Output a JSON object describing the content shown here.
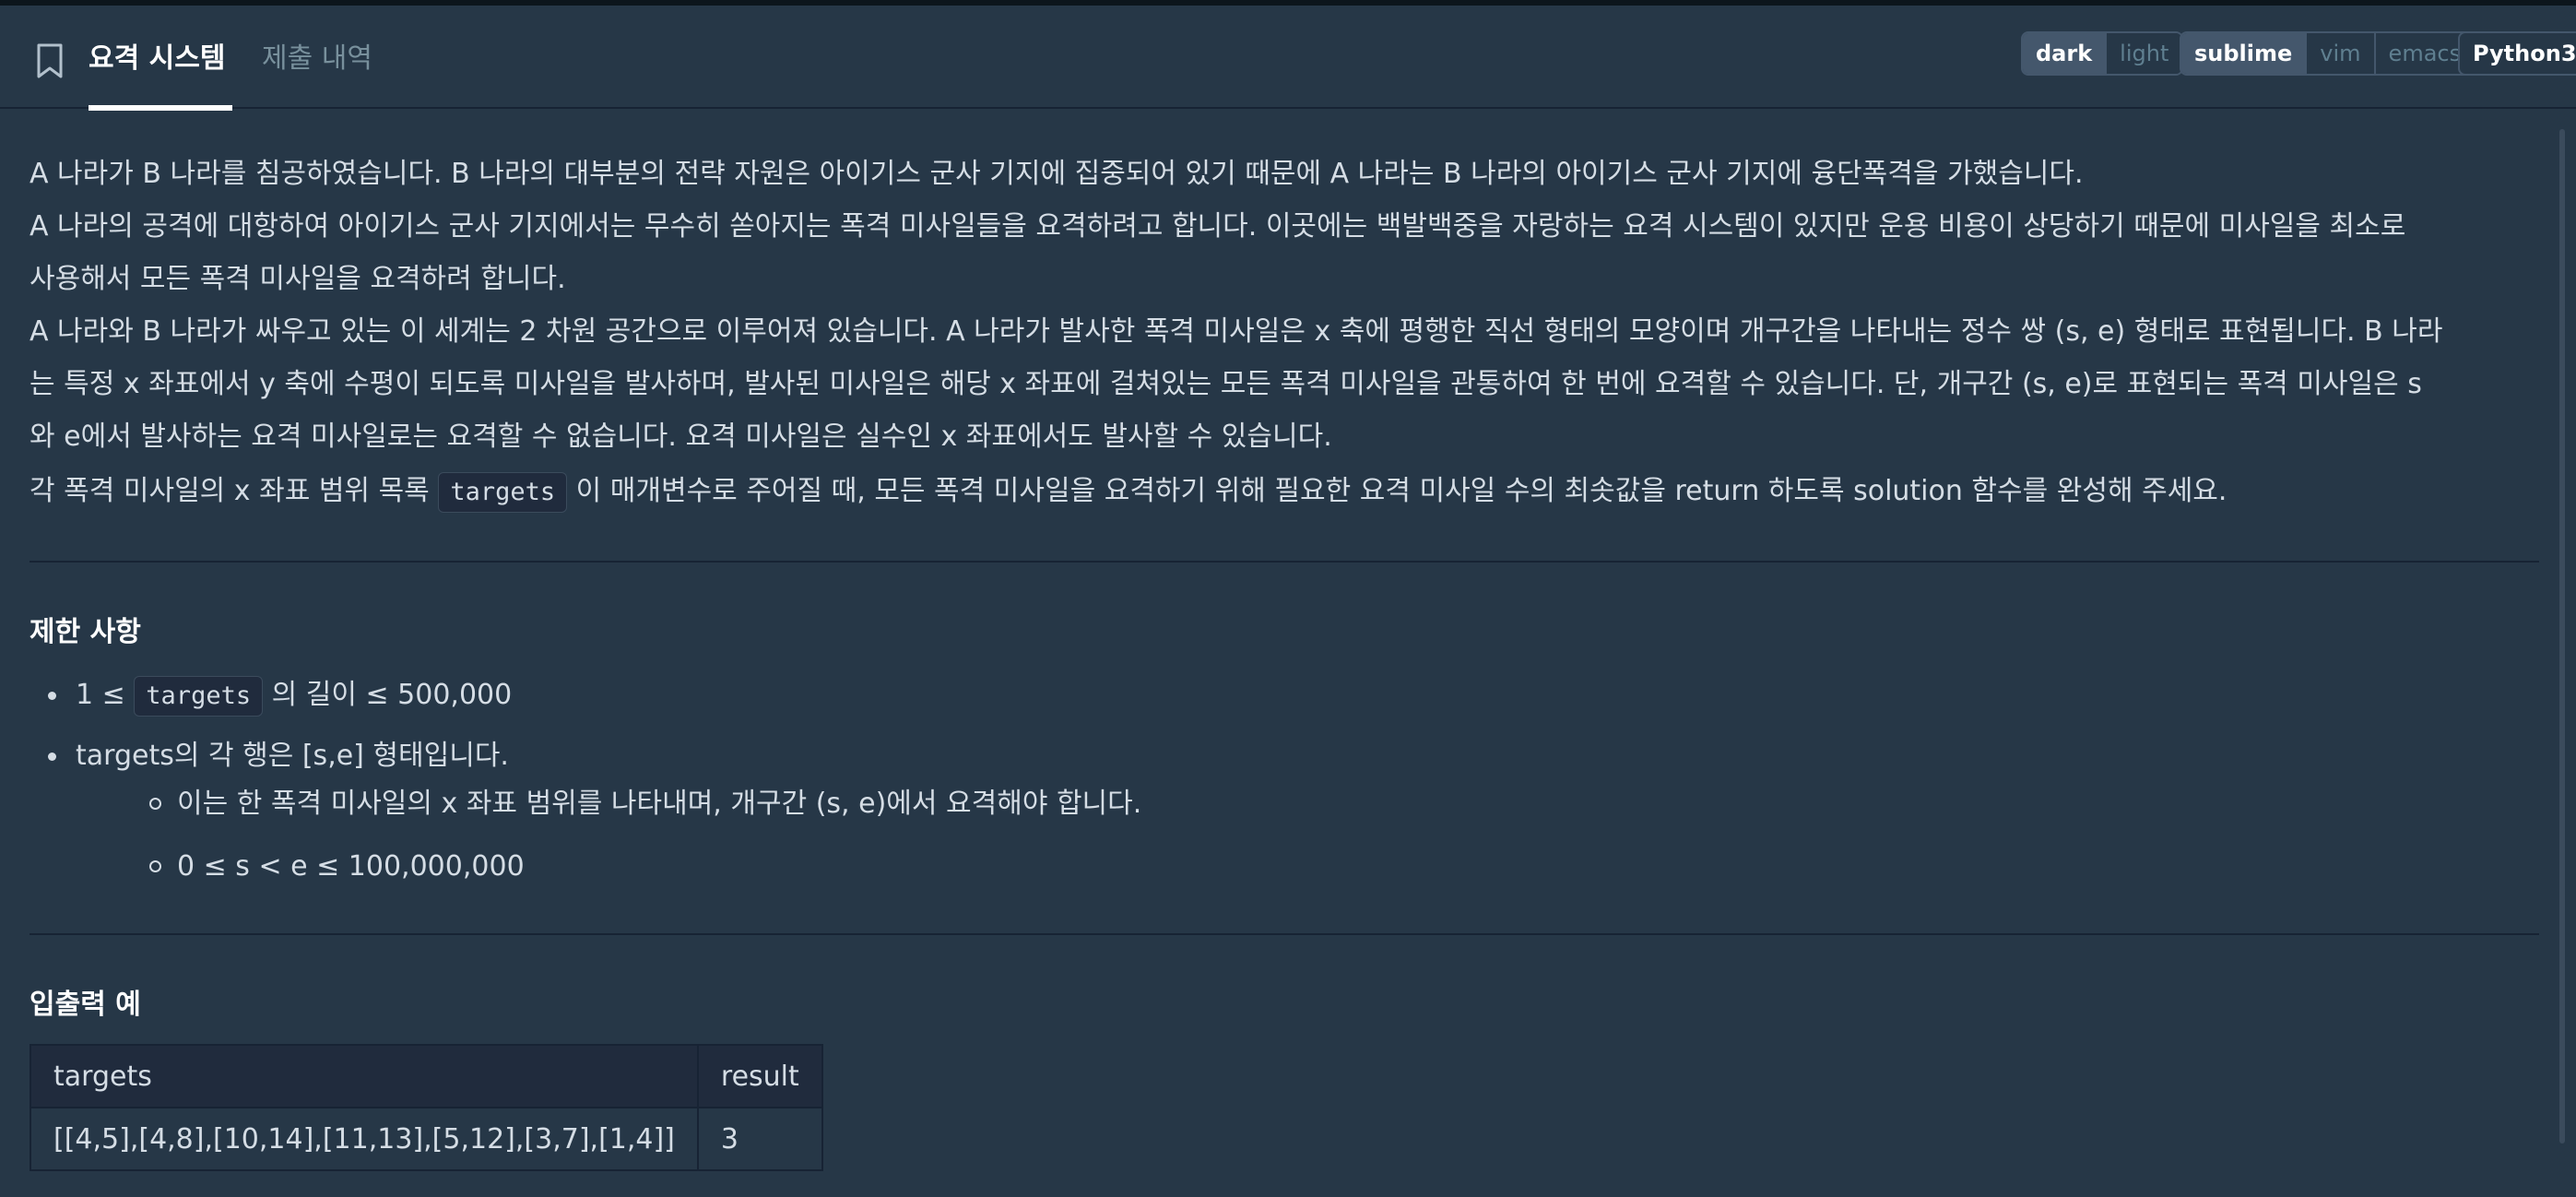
{
  "tabs": {
    "active": "요격 시스템",
    "inactive": "제출 내역"
  },
  "toolbar": {
    "theme_options": [
      "dark",
      "light"
    ],
    "editor_options": [
      "sublime",
      "vim",
      "emacs"
    ],
    "language": "Python3"
  },
  "description": {
    "p1": "A 나라가 B 나라를 침공하였습니다. B 나라의 대부분의 전략 자원은 아이기스 군사 기지에 집중되어 있기 때문에 A 나라는 B 나라의 아이기스 군사 기지에 융단폭격을 가했습니다.",
    "p2a": "A 나라의 공격에 대항하여 아이기스 군사 기지에서는 무수히 쏟아지는 폭격 미사일들을 요격하려고 합니다. 이곳에는 백발백중을 자랑하는 요격 시스템이 있지만 운용 비용이 상당하기 때문에 미사일을 최소로",
    "p2b": "사용해서 모든 폭격 미사일을 요격하려 합니다.",
    "p3a": "A 나라와 B 나라가 싸우고 있는 이 세계는 2 차원 공간으로 이루어져 있습니다. A 나라가 발사한 폭격 미사일은 x 축에 평행한 직선 형태의 모양이며 개구간을 나타내는 정수 쌍 (s, e) 형태로 표현됩니다. B 나라",
    "p3b": "는 특정 x 좌표에서 y 축에 수평이 되도록 미사일을 발사하며, 발사된 미사일은 해당 x 좌표에 걸쳐있는 모든 폭격 미사일을 관통하여 한 번에 요격할 수 있습니다. 단, 개구간 (s, e)로 표현되는 폭격 미사일은 s",
    "p3c": "와 e에서 발사하는 요격 미사일로는 요격할 수 없습니다. 요격 미사일은 실수인 x 좌표에서도 발사할 수 있습니다.",
    "p4_before": "각 폭격 미사일의 x 좌표 범위 목록 ",
    "p4_code": "targets",
    "p4_after": " 이 매개변수로 주어질 때, 모든 폭격 미사일을 요격하기 위해 필요한 요격 미사일 수의 최솟값을 return 하도록 solution 함수를 완성해 주세요."
  },
  "constraints": {
    "title": "제한 사항",
    "item1_before": "1 ≤ ",
    "item1_code": "targets",
    "item1_after": " 의 길이 ≤ 500,000",
    "item2": "targets의 각 행은 [s,e] 형태입니다.",
    "sub1": "이는 한 폭격 미사일의 x 좌표 범위를 나타내며, 개구간 (s, e)에서 요격해야 합니다.",
    "sub2": "0 ≤ s < e ≤ 100,000,000"
  },
  "examples": {
    "title": "입출력 예",
    "headers": [
      "targets",
      "result"
    ],
    "rows": [
      [
        "[[4,5],[4,8],[10,14],[11,13],[5,12],[3,7],[1,4]]",
        "3"
      ]
    ]
  }
}
